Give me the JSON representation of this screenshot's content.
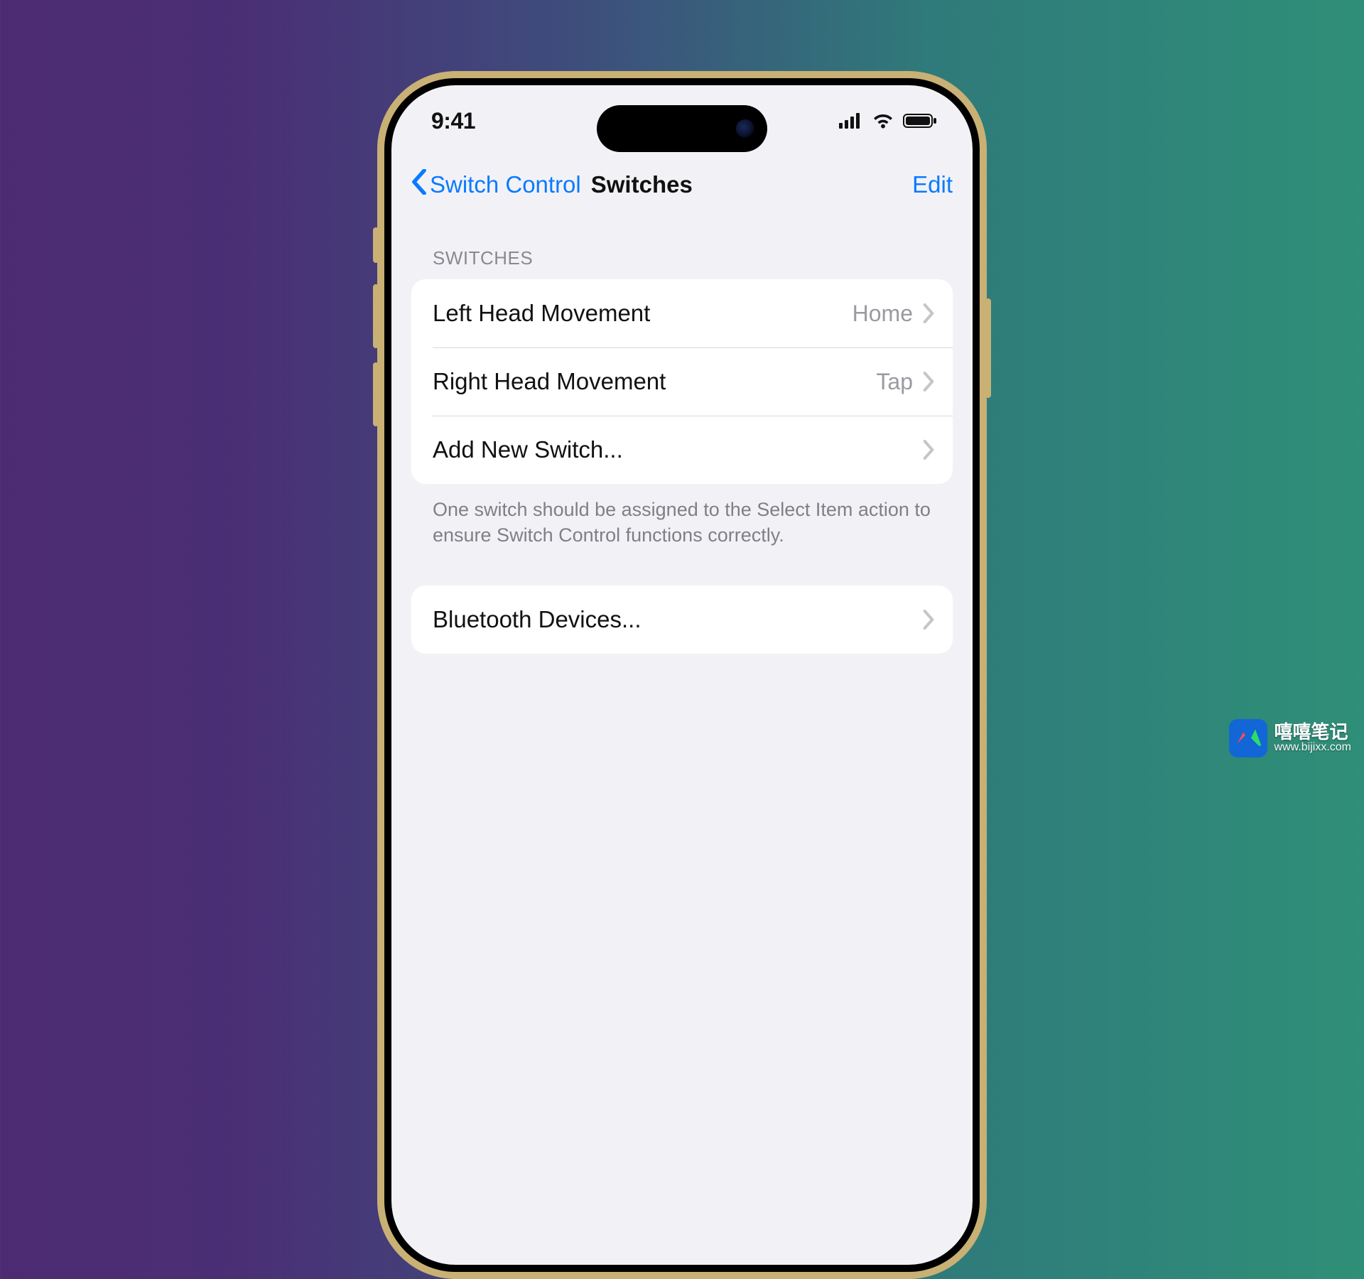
{
  "status": {
    "time": "9:41"
  },
  "nav": {
    "back_label": "Switch Control",
    "title": "Switches",
    "edit_label": "Edit"
  },
  "sections": {
    "switches": {
      "header": "SWITCHES",
      "rows": [
        {
          "label": "Left Head Movement",
          "value": "Home"
        },
        {
          "label": "Right Head Movement",
          "value": "Tap"
        },
        {
          "label": "Add New Switch...",
          "value": ""
        }
      ],
      "footer": "One switch should be assigned to the Select Item action to ensure Switch Control functions correctly."
    },
    "bluetooth": {
      "rows": [
        {
          "label": "Bluetooth Devices...",
          "value": ""
        }
      ]
    }
  },
  "watermark": {
    "name": "嘻嘻笔记",
    "url": "www.bijixx.com"
  }
}
